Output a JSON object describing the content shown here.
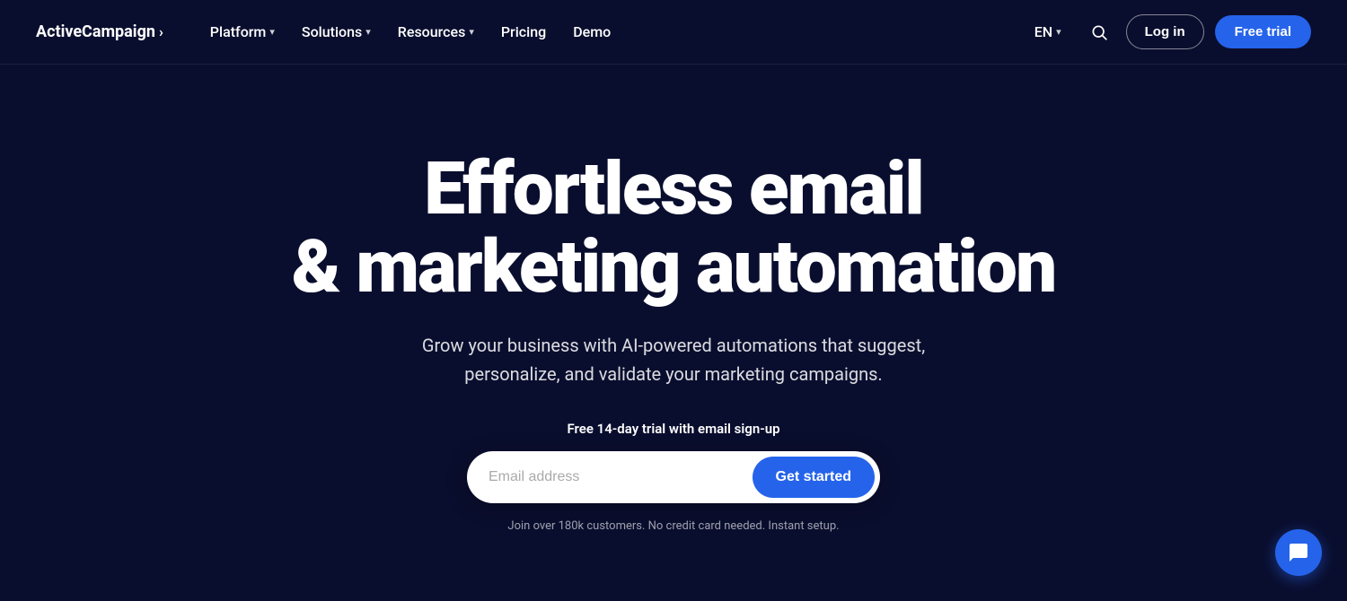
{
  "brand": {
    "name": "ActiveCampaign",
    "arrow": "›"
  },
  "nav": {
    "links": [
      {
        "id": "platform",
        "label": "Platform",
        "hasDropdown": true
      },
      {
        "id": "solutions",
        "label": "Solutions",
        "hasDropdown": true
      },
      {
        "id": "resources",
        "label": "Resources",
        "hasDropdown": true
      },
      {
        "id": "pricing",
        "label": "Pricing",
        "hasDropdown": false
      },
      {
        "id": "demo",
        "label": "Demo",
        "hasDropdown": false
      }
    ],
    "lang": "EN",
    "login_label": "Log in",
    "free_trial_label": "Free trial"
  },
  "hero": {
    "title_line1": "Effortless email",
    "title_line2": "& marketing automation",
    "subtitle": "Grow your business with AI-powered automations that suggest, personalize, and validate your marketing campaigns.",
    "trial_text": "Free 14-day trial with email sign-up",
    "email_placeholder": "Email address",
    "cta_label": "Get started",
    "fine_print": "Join over 180k customers. No credit card needed. Instant setup."
  },
  "colors": {
    "background": "#0a0e2e",
    "accent": "#2563eb",
    "white": "#ffffff"
  }
}
